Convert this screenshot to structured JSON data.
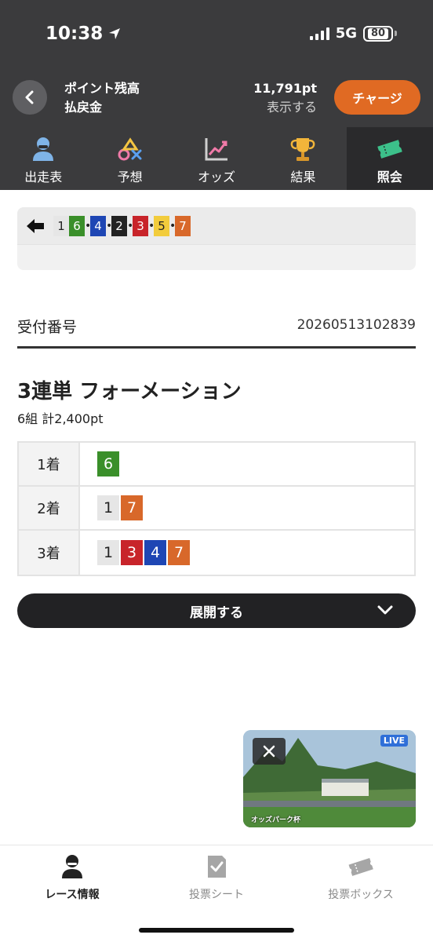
{
  "status_bar": {
    "time": "10:38",
    "network": "5G",
    "battery": "80"
  },
  "header": {
    "back_icon": "chevron-left-icon",
    "points_label": "ポイント残高",
    "points_value": "11,791pt",
    "refund_label": "払戻金",
    "refund_value": "表示する",
    "charge_button": "チャージ",
    "accent": "#e06a23"
  },
  "nav": {
    "items": [
      {
        "label": "出走表",
        "icon": "racer-icon"
      },
      {
        "label": "予想",
        "icon": "prediction-icon"
      },
      {
        "label": "オッズ",
        "icon": "odds-chart-icon"
      },
      {
        "label": "結果",
        "icon": "trophy-icon"
      },
      {
        "label": "照会",
        "icon": "ticket-icon",
        "active": true
      }
    ]
  },
  "order_strip": {
    "chips": [
      {
        "n": "1",
        "bg": "#e6e6e6",
        "fg": "#222"
      },
      {
        "n": "6",
        "bg": "#3a8f2a",
        "fg": "#fff"
      },
      {
        "n": "4",
        "bg": "#1e46b4",
        "fg": "#fff"
      },
      {
        "n": "2",
        "bg": "#222222",
        "fg": "#fff"
      },
      {
        "n": "3",
        "bg": "#c8242a",
        "fg": "#fff"
      },
      {
        "n": "5",
        "bg": "#f2cc3c",
        "fg": "#222"
      },
      {
        "n": "7",
        "bg": "#d8682a",
        "fg": "#fff"
      }
    ],
    "separator": "•"
  },
  "receipt": {
    "label": "受付番号",
    "number": "20260513102839"
  },
  "bet": {
    "title": "3連単 フォーメーション",
    "summary": "6組 計2,400pt",
    "rows": [
      {
        "label": "1着",
        "nums": [
          {
            "n": "6",
            "bg": "#3a8f2a",
            "fg": "#fff"
          }
        ]
      },
      {
        "label": "2着",
        "nums": [
          {
            "n": "1",
            "bg": "#e6e6e6",
            "fg": "#222"
          },
          {
            "n": "7",
            "bg": "#d8682a",
            "fg": "#fff"
          }
        ]
      },
      {
        "label": "3着",
        "nums": [
          {
            "n": "1",
            "bg": "#e6e6e6",
            "fg": "#222"
          },
          {
            "n": "3",
            "bg": "#c8242a",
            "fg": "#fff"
          },
          {
            "n": "4",
            "bg": "#1e46b4",
            "fg": "#fff"
          },
          {
            "n": "7",
            "bg": "#d8682a",
            "fg": "#fff"
          }
        ]
      }
    ]
  },
  "expand_button": "展開する",
  "live_video": {
    "badge": "LIVE",
    "caption": "オッズパーク杯"
  },
  "tabbar": {
    "items": [
      {
        "label": "レース情報",
        "icon": "racer-icon",
        "active": true
      },
      {
        "label": "投票シート",
        "icon": "check-sheet-icon"
      },
      {
        "label": "投票ボックス",
        "icon": "ticket-box-icon"
      }
    ]
  }
}
